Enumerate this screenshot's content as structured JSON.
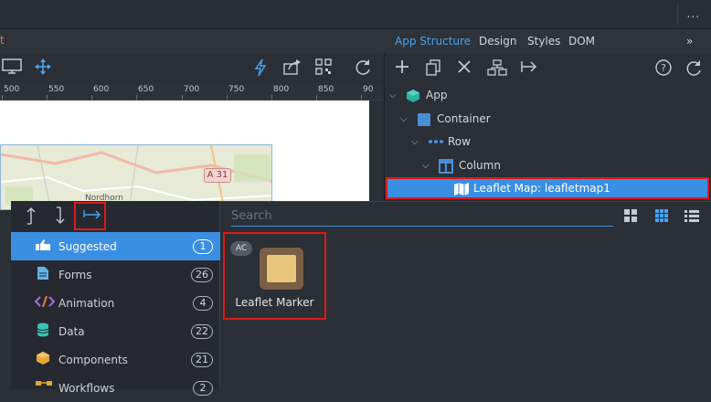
{
  "topbar": {
    "more_label": "..."
  },
  "canvas": {
    "tab_fragment": "t",
    "ruler_ticks": [
      "500",
      "550",
      "600",
      "650",
      "700",
      "750",
      "800",
      "850",
      "90"
    ],
    "map": {
      "road_badge": "A 31",
      "place_label": "Nordhorn"
    }
  },
  "structure_panel": {
    "tabs": [
      {
        "label": "App Structure",
        "active": true
      },
      {
        "label": "Design",
        "active": false
      },
      {
        "label": "Styles",
        "active": false
      },
      {
        "label": "DOM",
        "active": false
      }
    ],
    "collapse_label": "»",
    "tree": [
      {
        "label": "App",
        "icon": "cube-icon"
      },
      {
        "label": "Container",
        "icon": "square-icon"
      },
      {
        "label": "Row",
        "icon": "dots-icon"
      },
      {
        "label": "Column",
        "icon": "columns-icon"
      },
      {
        "label": "Leaflet Map: leafletmap1",
        "icon": "map-icon",
        "selected": true
      }
    ]
  },
  "picker": {
    "search_placeholder": "Search",
    "categories": [
      {
        "label": "Suggested",
        "count": "1",
        "icon": "thumb-icon",
        "active": true
      },
      {
        "label": "Forms",
        "count": "26",
        "icon": "form-icon"
      },
      {
        "label": "Animation",
        "count": "4",
        "icon": "code-icon"
      },
      {
        "label": "Data",
        "count": "22",
        "icon": "database-icon"
      },
      {
        "label": "Components",
        "count": "21",
        "icon": "box-icon"
      },
      {
        "label": "Workflows",
        "count": "2",
        "icon": "workflow-icon"
      }
    ],
    "components": [
      {
        "label": "Leaflet Marker",
        "badge": "AC"
      }
    ]
  },
  "colors": {
    "accent": "#3a8fe3",
    "highlight": "#e01818",
    "panel_bg": "#2b2f36"
  }
}
